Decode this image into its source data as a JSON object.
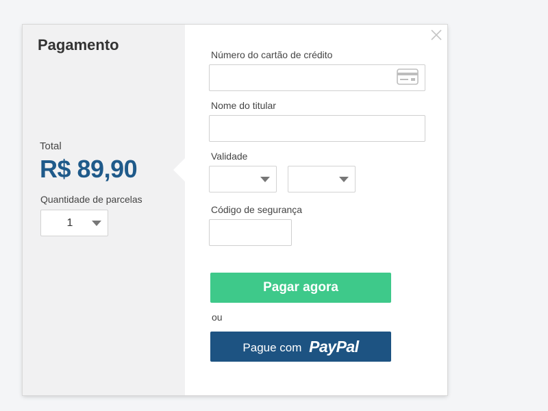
{
  "summary": {
    "title": "Pagamento",
    "total_label": "Total",
    "total_value": "R$ 89,90",
    "installments_label": "Quantidade de parcelas",
    "installments_value": "1"
  },
  "form": {
    "card_number_label": "Número do cartão de crédito",
    "card_number_value": "",
    "holder_label": "Nome do titular",
    "holder_value": "",
    "expiry_label": "Validade",
    "expiry_month_value": "",
    "expiry_year_value": "",
    "cvv_label": "Código de segurança",
    "cvv_value": ""
  },
  "actions": {
    "pay_label": "Pagar agora",
    "or_label": "ou",
    "paypal_prefix": "Pague com",
    "paypal_brand": "PayPal"
  },
  "icons": {
    "close": "close-icon",
    "card": "credit-card-icon",
    "caret": "chevron-down-icon"
  },
  "colors": {
    "accent_blue": "#1f5a8a",
    "pay_green": "#3ec98a",
    "paypal_blue": "#1d5382",
    "summary_bg": "#f1f1f2"
  }
}
